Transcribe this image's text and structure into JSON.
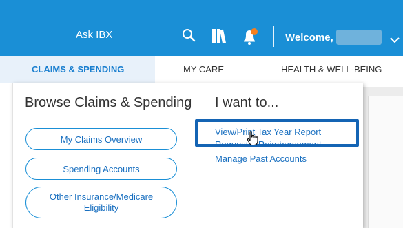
{
  "header": {
    "search_placeholder": "Ask IBX",
    "welcome": "Welcome,",
    "search_icon": "search-icon",
    "books_icon": "books-icon",
    "bell_icon": "bell-icon",
    "chevron_icon": "chevron-down-icon",
    "brand_color": "#1a8fd6",
    "notification_color": "#f7801e"
  },
  "nav": {
    "tabs": [
      {
        "label": "CLAIMS & SPENDING",
        "active": true
      },
      {
        "label": "MY CARE",
        "active": false
      },
      {
        "label": "HEALTH & WELL-BEING",
        "active": false
      }
    ]
  },
  "dropdown": {
    "browse_heading": "Browse Claims & Spending",
    "want_heading": "I want to...",
    "buttons": [
      "My Claims Overview",
      "Spending Accounts",
      "Other Insurance/Medicare Eligibility"
    ],
    "links": [
      "View/Print Tax Year Report",
      "Request a Reimbursement",
      "Manage Past Accounts"
    ]
  }
}
